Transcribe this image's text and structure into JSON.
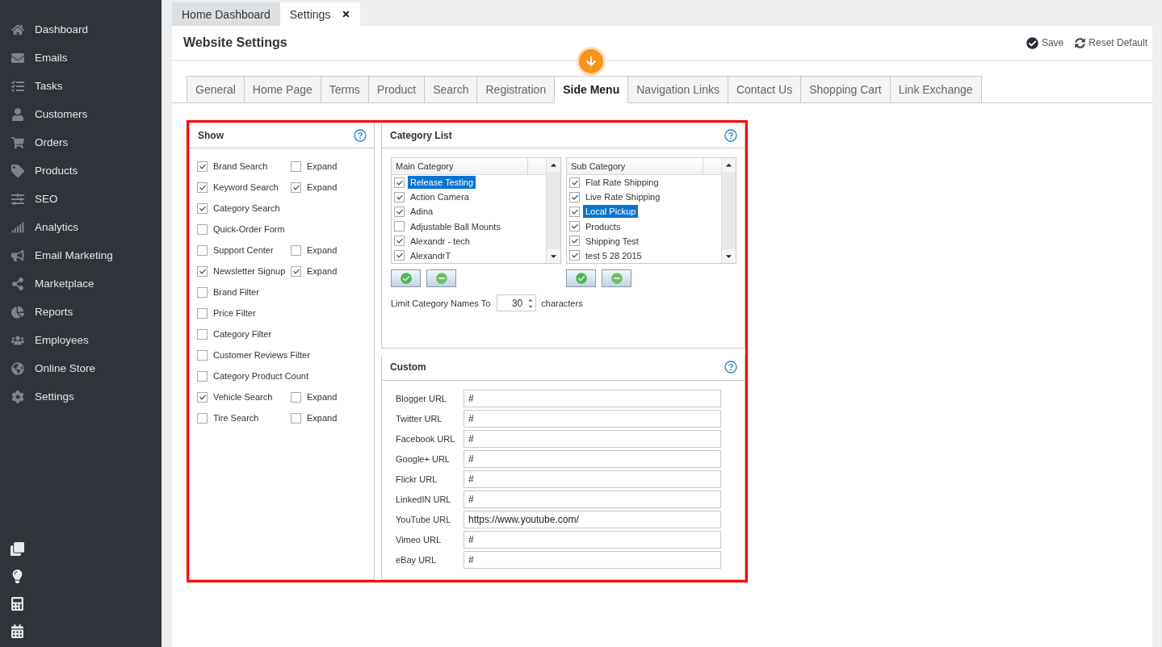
{
  "sidebar": {
    "items": [
      {
        "label": "Dashboard"
      },
      {
        "label": "Emails"
      },
      {
        "label": "Tasks"
      },
      {
        "label": "Customers"
      },
      {
        "label": "Orders"
      },
      {
        "label": "Products"
      },
      {
        "label": "SEO"
      },
      {
        "label": "Analytics"
      },
      {
        "label": "Email Marketing"
      },
      {
        "label": "Marketplace"
      },
      {
        "label": "Reports"
      },
      {
        "label": "Employees"
      },
      {
        "label": "Online Store"
      },
      {
        "label": "Settings"
      }
    ]
  },
  "page_tabs": [
    {
      "label": "Home Dashboard",
      "selected": false,
      "closable": false
    },
    {
      "label": "Settings",
      "selected": true,
      "closable": true
    }
  ],
  "header": {
    "title": "Website Settings",
    "actions": [
      {
        "kind": "save",
        "label": "Save"
      },
      {
        "kind": "reset",
        "label": "Reset Default"
      }
    ]
  },
  "tabs": [
    {
      "label": "General",
      "selected": false
    },
    {
      "label": "Home Page",
      "selected": false
    },
    {
      "label": "Terms",
      "selected": false
    },
    {
      "label": "Product",
      "selected": false
    },
    {
      "label": "Search",
      "selected": false
    },
    {
      "label": "Registration",
      "selected": false
    },
    {
      "label": "Side Menu",
      "selected": true
    },
    {
      "label": "Navigation Links",
      "selected": false
    },
    {
      "label": "Contact Us",
      "selected": false
    },
    {
      "label": "Shopping Cart",
      "selected": false
    },
    {
      "label": "Link Exchange",
      "selected": false
    }
  ],
  "show": {
    "title": "Show",
    "items": [
      {
        "label": "Brand Search",
        "checked": true,
        "expand": {
          "label": "Expand",
          "checked": false
        }
      },
      {
        "label": "Keyword Search",
        "checked": true,
        "expand": {
          "label": "Expand",
          "checked": true
        }
      },
      {
        "label": "Category Search",
        "checked": true
      },
      {
        "label": "Quick-Order Form",
        "checked": false
      },
      {
        "label": "Support Center",
        "checked": false,
        "expand": {
          "label": "Expand",
          "checked": false
        }
      },
      {
        "label": "Newsletter Signup",
        "checked": true,
        "expand": {
          "label": "Expand",
          "checked": true
        }
      },
      {
        "label": "Brand Filter",
        "checked": false
      },
      {
        "label": "Price Filter",
        "checked": false
      },
      {
        "label": "Category Filter",
        "checked": false
      },
      {
        "label": "Customer Reviews Filter",
        "checked": false
      },
      {
        "label": "Category Product Count",
        "checked": false
      },
      {
        "label": "Vehicle Search",
        "checked": true,
        "expand": {
          "label": "Expand",
          "checked": false
        }
      },
      {
        "label": "Tire Search",
        "checked": false,
        "expand": {
          "label": "Expand",
          "checked": false
        }
      }
    ]
  },
  "category_list": {
    "title": "Category List",
    "lists": [
      {
        "header": "Main Category",
        "items": [
          {
            "label": "Release Testing",
            "checked": true,
            "selected": true
          },
          {
            "label": "Action Camera",
            "checked": true,
            "selected": false
          },
          {
            "label": "Adina",
            "checked": true,
            "selected": false
          },
          {
            "label": "Adjustable Ball Mounts",
            "checked": false,
            "selected": false
          },
          {
            "label": "Alexandr - tech",
            "checked": true,
            "selected": false
          },
          {
            "label": "AlexandrT",
            "checked": true,
            "selected": false
          }
        ]
      },
      {
        "header": "Sub Category",
        "items": [
          {
            "label": "Flat Rate Shipping",
            "checked": true,
            "selected": false
          },
          {
            "label": "Live Rate Shipping",
            "checked": true,
            "selected": false
          },
          {
            "label": "Local Pickup",
            "checked": true,
            "selected": true
          },
          {
            "label": "Products",
            "checked": true,
            "selected": false
          },
          {
            "label": "Shipping Test",
            "checked": true,
            "selected": false
          },
          {
            "label": "test 5 28 2015",
            "checked": true,
            "selected": false
          }
        ]
      }
    ],
    "limit": {
      "label": "Limit Category Names To",
      "value": "30",
      "suffix": "characters"
    }
  },
  "custom": {
    "title": "Custom",
    "fields": [
      {
        "label": "Blogger URL",
        "value": "#"
      },
      {
        "label": "Twitter URL",
        "value": "#"
      },
      {
        "label": "Facebook URL",
        "value": "#"
      },
      {
        "label": "Google+ URL",
        "value": "#"
      },
      {
        "label": "Flickr URL",
        "value": "#"
      },
      {
        "label": "LinkedIN URL",
        "value": "#"
      },
      {
        "label": "YouTube URL",
        "value": "https://www.youtube.com/"
      },
      {
        "label": "Vimeo URL",
        "value": "#"
      },
      {
        "label": "eBay URL",
        "value": "#"
      }
    ]
  }
}
